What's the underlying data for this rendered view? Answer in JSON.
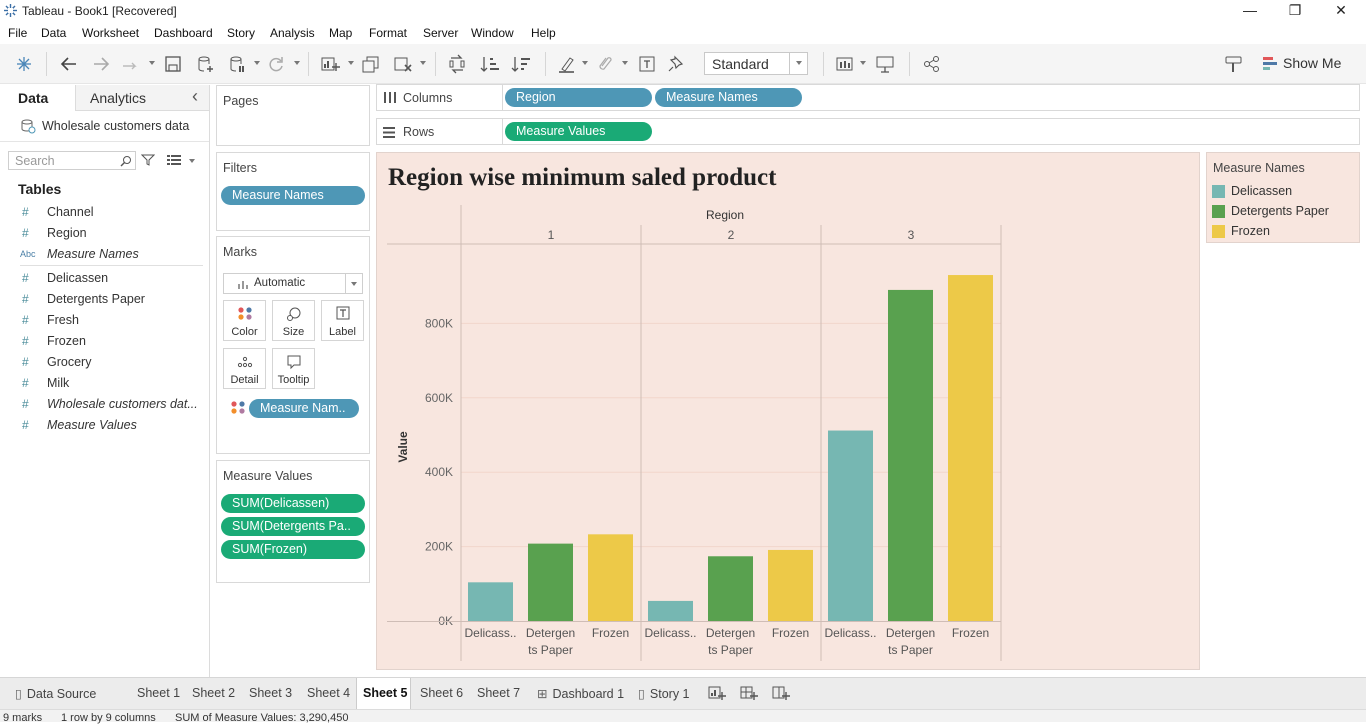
{
  "window": {
    "title": "Tableau - Book1 [Recovered]",
    "minimize": "—",
    "restore": "❐",
    "close": "✕"
  },
  "menu": [
    "File",
    "Data",
    "Worksheet",
    "Dashboard",
    "Story",
    "Analysis",
    "Map",
    "Format",
    "Server",
    "Window",
    "Help"
  ],
  "toolbar": {
    "fit_select": "Standard",
    "show_me_label": "Show Me"
  },
  "data_pane": {
    "tab_data": "Data",
    "tab_analytics": "Analytics",
    "collapse_icon": "‹",
    "datasource": "Wholesale customers data",
    "search_placeholder": "Search",
    "tables_header": "Tables",
    "fields": [
      {
        "icon": "#",
        "name": "Channel",
        "italic": false
      },
      {
        "icon": "#",
        "name": "Region",
        "italic": false
      },
      {
        "icon": "Abc",
        "name": "Measure Names",
        "italic": true
      },
      {
        "icon": "#",
        "name": "Delicassen",
        "italic": false
      },
      {
        "icon": "#",
        "name": "Detergents Paper",
        "italic": false
      },
      {
        "icon": "#",
        "name": "Fresh",
        "italic": false
      },
      {
        "icon": "#",
        "name": "Frozen",
        "italic": false
      },
      {
        "icon": "#",
        "name": "Grocery",
        "italic": false
      },
      {
        "icon": "#",
        "name": "Milk",
        "italic": false
      },
      {
        "icon": "#",
        "name": "Wholesale customers dat...",
        "italic": true
      },
      {
        "icon": "#",
        "name": "Measure Values",
        "italic": true
      }
    ]
  },
  "cards": {
    "pages": "Pages",
    "filters": "Filters",
    "filter_pill": "Measure Names",
    "marks": "Marks",
    "mark_type": "Automatic",
    "mark_buttons": [
      "Color",
      "Size",
      "Label",
      "Detail",
      "Tooltip"
    ],
    "marks_pill": "Measure Nam..",
    "measure_values": "Measure Values",
    "measure_pills": [
      "SUM(Delicassen)",
      "SUM(Detergents Pa..",
      "SUM(Frozen)"
    ]
  },
  "shelves": {
    "columns_label": "Columns",
    "columns_pills": [
      "Region",
      "Measure Names"
    ],
    "rows_label": "Rows",
    "rows_pills": [
      "Measure Values"
    ]
  },
  "legend": {
    "title": "Measure Names",
    "items": [
      {
        "name": "Delicassen",
        "color": "#76b7b2"
      },
      {
        "name": "Detergents Paper",
        "color": "#59a14f"
      },
      {
        "name": "Frozen",
        "color": "#edc948"
      }
    ]
  },
  "chart_data": {
    "type": "bar",
    "title": "Region wise minimum saled product",
    "column_header": "Region",
    "ylabel": "Value",
    "ylim": [
      0,
      1000000
    ],
    "yticks": [
      0,
      200000,
      400000,
      600000,
      800000
    ],
    "ytick_labels": [
      "0K",
      "200K",
      "400K",
      "600K",
      "800K"
    ],
    "panes": [
      "1",
      "2",
      "3"
    ],
    "categories": [
      "Delicassen",
      "Detergents Paper",
      "Frozen"
    ],
    "category_labels": [
      [
        "Delicass.."
      ],
      [
        "Detergen",
        "ts Paper"
      ],
      [
        "Frozen"
      ]
    ],
    "colors": [
      "#76b7b2",
      "#59a14f",
      "#edc948"
    ],
    "values": [
      [
        104000,
        208000,
        233000
      ],
      [
        54000,
        174000,
        191000
      ],
      [
        512000,
        890000,
        930000
      ]
    ]
  },
  "sheet_tabs": [
    {
      "label": "Data Source",
      "icon": "▯",
      "active": false
    },
    {
      "label": "Sheet 1",
      "icon": "",
      "active": false
    },
    {
      "label": "Sheet 2",
      "icon": "",
      "active": false
    },
    {
      "label": "Sheet 3",
      "icon": "",
      "active": false
    },
    {
      "label": "Sheet 4",
      "icon": "",
      "active": false
    },
    {
      "label": "Sheet 5",
      "icon": "",
      "active": true
    },
    {
      "label": "Sheet 6",
      "icon": "",
      "active": false
    },
    {
      "label": "Sheet 7",
      "icon": "",
      "active": false
    },
    {
      "label": "Dashboard 1",
      "icon": "⊞",
      "active": false
    },
    {
      "label": "Story 1",
      "icon": "▯",
      "active": false
    }
  ],
  "status": {
    "marks": "9 marks",
    "rows_cols": "1 row by 9 columns",
    "sum": "SUM of Measure Values: 3,290,450"
  }
}
